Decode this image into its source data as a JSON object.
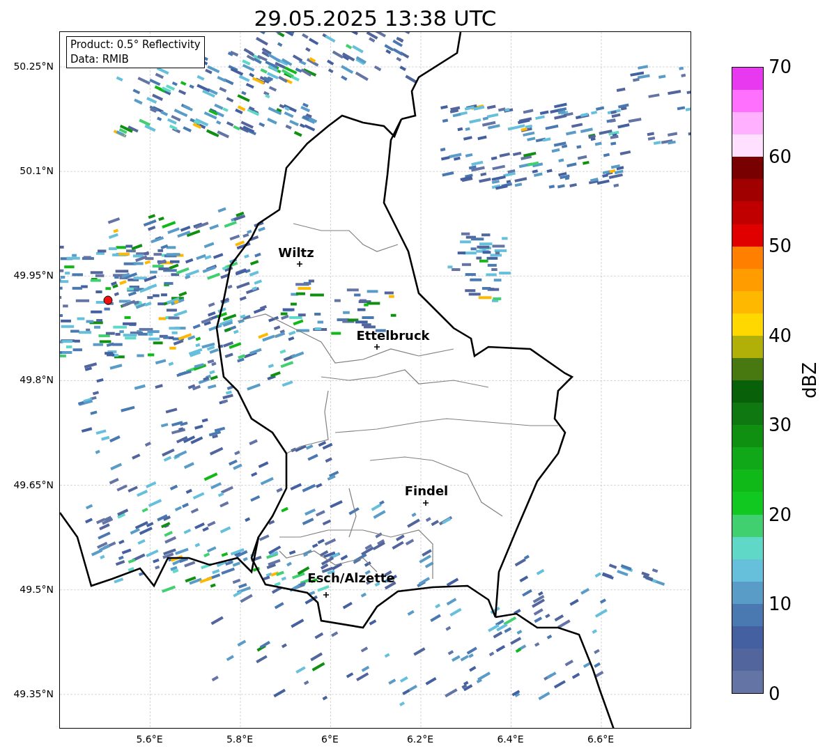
{
  "title": "29.05.2025 13:38 UTC",
  "info_box": {
    "lines": [
      "Product: 0.5° Reflectivity",
      "Data: RMIB"
    ]
  },
  "map": {
    "xticks": [
      "5.6°E",
      "5.8°E",
      "6°E",
      "6.2°E",
      "6.4°E",
      "6.6°E"
    ],
    "yticks": [
      "50.25°N",
      "50.1°N",
      "49.95°N",
      "49.8°N",
      "49.65°N",
      "49.5°N",
      "49.35°N"
    ],
    "cities": [
      {
        "name": "Wiltz"
      },
      {
        "name": "Ettelbruck"
      },
      {
        "name": "Findel"
      },
      {
        "name": "Esch/Alzette"
      }
    ]
  },
  "colorbar": {
    "label": "dBZ",
    "ticks": [
      "70",
      "60",
      "50",
      "40",
      "30",
      "20",
      "10",
      "0"
    ],
    "bins": [
      {
        "color": "#e838f0"
      },
      {
        "color": "#ff70ff"
      },
      {
        "color": "#ffb0ff"
      },
      {
        "color": "#ffe0ff"
      },
      {
        "color": "#780000"
      },
      {
        "color": "#a00000"
      },
      {
        "color": "#c00000"
      },
      {
        "color": "#e00000"
      },
      {
        "color": "#ff8000"
      },
      {
        "color": "#ff9c00"
      },
      {
        "color": "#ffb800"
      },
      {
        "color": "#ffd800"
      },
      {
        "color": "#b0b008"
      },
      {
        "color": "#487810"
      },
      {
        "color": "#086008"
      },
      {
        "color": "#107810"
      },
      {
        "color": "#109010"
      },
      {
        "color": "#10a818"
      },
      {
        "color": "#10b818"
      },
      {
        "color": "#10c820"
      },
      {
        "color": "#40d070"
      },
      {
        "color": "#60d8c8"
      },
      {
        "color": "#66c0dc"
      },
      {
        "color": "#5a9cc8"
      },
      {
        "color": "#4a78b0"
      },
      {
        "color": "#4560a0"
      },
      {
        "color": "#52659c"
      },
      {
        "color": "#6474a4"
      }
    ]
  }
}
